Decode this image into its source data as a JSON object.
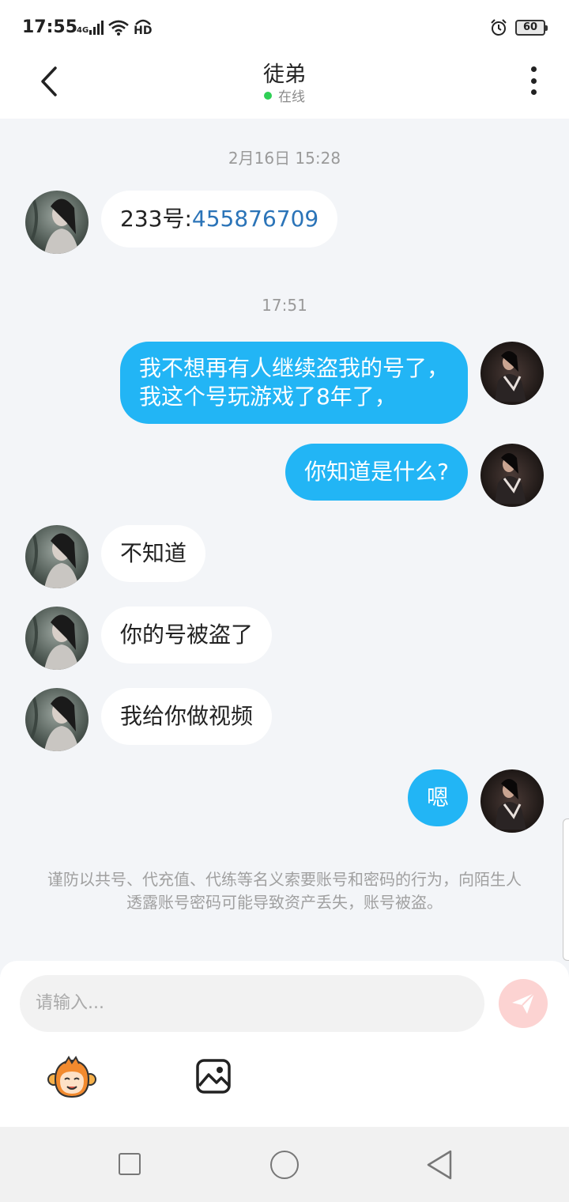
{
  "status_bar": {
    "time": "17:55",
    "network": "4G",
    "hd": "HD",
    "battery": "60"
  },
  "header": {
    "title": "徒弟",
    "status": "在线"
  },
  "messages": [
    {
      "type": "timestamp",
      "text": "2月16日 15:28"
    },
    {
      "type": "in",
      "prefix": "233号:",
      "number": "455876709"
    },
    {
      "type": "timestamp",
      "text": "17:51"
    },
    {
      "type": "out",
      "lines": [
        "我不想再有人继续盗我的号了，",
        "我这个号玩游戏了8年了，"
      ]
    },
    {
      "type": "out",
      "text": "你知道是什么?"
    },
    {
      "type": "in",
      "text": "不知道"
    },
    {
      "type": "in",
      "text": "你的号被盗了"
    },
    {
      "type": "in",
      "text": "我给你做视频"
    },
    {
      "type": "out",
      "text": "嗯"
    }
  ],
  "notice": "谨防以共号、代充值、代练等名义索要账号和密码的行为，向陌生人透露账号密码可能导致资产丢失，账号被盗。",
  "input": {
    "placeholder": "请输入..."
  },
  "colors": {
    "outgoing_bubble": "#22b5f5",
    "incoming_bubble": "#ffffff",
    "online_dot": "#2fcf55",
    "link": "#2b74b8",
    "send_button": "#fcd3d2"
  },
  "icons": {
    "back": "chevron-left-icon",
    "more": "more-vertical-icon",
    "emoji": "monkey-emoji-icon",
    "image": "image-icon",
    "send": "paper-plane-icon"
  }
}
